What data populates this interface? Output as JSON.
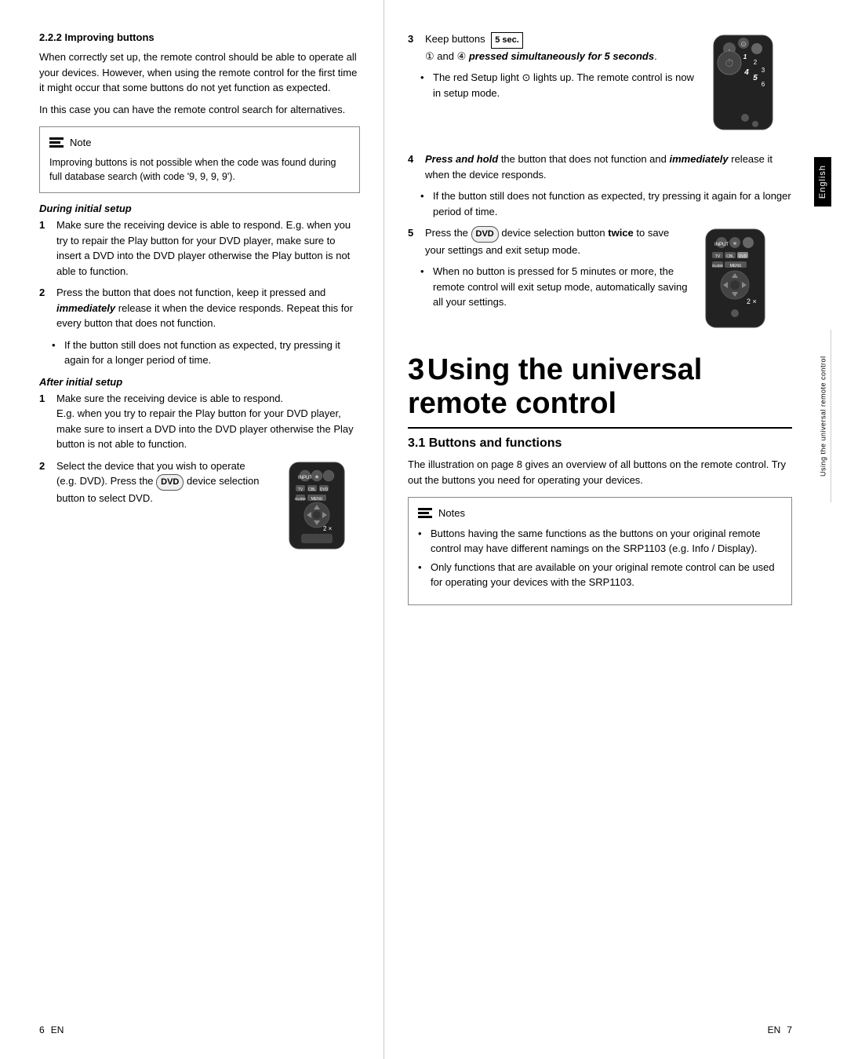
{
  "leftPage": {
    "pageNum": "6",
    "pageLang": "EN",
    "section222": {
      "heading": "2.2.2   Improving buttons",
      "para1": "When correctly set up, the remote control should be able to operate all your devices. However, when using the remote control for the first time it might occur that some buttons do not yet function as expected.",
      "para2": "In this case you can have the remote control search for alternatives."
    },
    "noteBox": {
      "label": "Note",
      "text": "Improving buttons is not possible when the code was found during full database search (with code '9, 9, 9, 9')."
    },
    "duringInitialSetup": {
      "heading": "During initial setup",
      "steps": [
        {
          "num": "1",
          "text": "Make sure the receiving device is able to respond. E.g. when you try to repair the Play button for your DVD player, make sure to insert a DVD into the DVD player otherwise the Play button is not able to function."
        },
        {
          "num": "2",
          "text": "Press the button that does not function, keep it pressed and ",
          "boldItalic": "immediately",
          "textAfter": " release it when the device responds. Repeat this for every button that does not function."
        }
      ],
      "bullet1": "If the button still does not function as expected, try pressing it again for a longer period of time."
    },
    "afterInitialSetup": {
      "heading": "After initial setup",
      "steps": [
        {
          "num": "1",
          "text": "Make sure the receiving device is able to respond.",
          "subText": "E.g. when you try to repair the Play button for your DVD player, make sure to insert a DVD into the DVD player otherwise the Play button is not able to function."
        },
        {
          "num": "2",
          "text": "Select the device that you wish to operate (e.g. DVD). Press the ",
          "btnLabel": "DVD",
          "textAfter": " device selection button to select DVD."
        }
      ]
    }
  },
  "rightPage": {
    "pageNum": "7",
    "pageLang": "EN",
    "sideTab": "English",
    "sideTabRight": "Using the universal remote control",
    "step3": {
      "num": "3",
      "textBefore": "Keep buttons",
      "secLabel": "5 sec.",
      "circled1": "①",
      "circled4": "④",
      "boldItalic": "pressed simultaneously for 5 seconds",
      "bullet": "The red Setup light ⊙ lights up. The remote control is now in setup mode."
    },
    "step4": {
      "num": "4",
      "textBefore": "Press and hold",
      "bold": "Press and hold",
      "text": " the button that does not function and ",
      "boldItalic2": "immediately",
      "textAfter": " release it when the device responds.",
      "bullet": "If the button still does not function as expected, try pressing it again for a longer period of time."
    },
    "step5": {
      "num": "5",
      "textBefore": "Press the ",
      "btnLabel": "DVD",
      "textAfter": " device selection button ",
      "bold2": "twice",
      "textAfter2": " to save your settings and exit setup mode.",
      "bullet": "When no button is pressed for 5 minutes or more, the remote control will exit setup mode, automatically saving all your settings."
    },
    "chapter3": {
      "num": "3",
      "title": "Using the universal remote control"
    },
    "section31": {
      "heading": "3.1   Buttons and functions",
      "para": "The illustration on page 8 gives an overview of all buttons on the remote control. Try out the buttons you need for operating your devices."
    },
    "notesBox": {
      "label": "Notes",
      "bullets": [
        "Buttons having the same functions as the buttons on your original remote control may have different namings on the SRP1103 (e.g. Info / Display).",
        "Only functions that are available on your original remote control can be used for operating your devices with the SRP1103."
      ]
    }
  }
}
